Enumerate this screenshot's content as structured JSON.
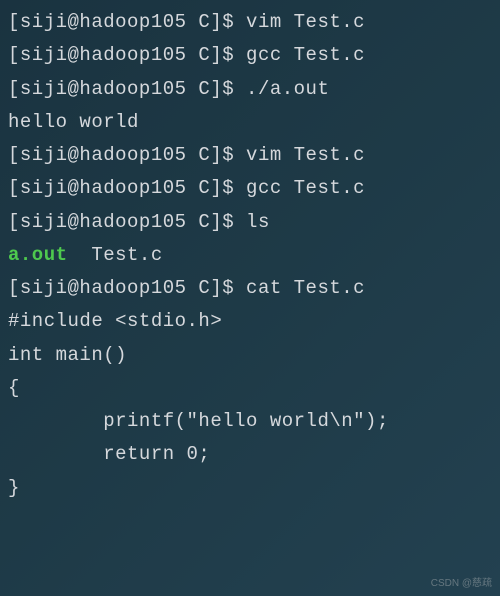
{
  "prompt": "[siji@hadoop105 C]$ ",
  "lines": [
    {
      "type": "cmd",
      "command": "vim Test.c"
    },
    {
      "type": "cmd",
      "command": "gcc Test.c"
    },
    {
      "type": "cmd",
      "command": "./a.out"
    },
    {
      "type": "out",
      "text": "hello world"
    },
    {
      "type": "cmd",
      "command": "vim Test.c"
    },
    {
      "type": "cmd",
      "command": "gcc Test.c"
    },
    {
      "type": "cmd",
      "command": "ls"
    },
    {
      "type": "ls",
      "executable": "a.out",
      "rest": "  Test.c"
    },
    {
      "type": "cmd",
      "command": "cat Test.c"
    },
    {
      "type": "out",
      "text": "#include <stdio.h>"
    },
    {
      "type": "out",
      "text": "int main()"
    },
    {
      "type": "out",
      "text": "{"
    },
    {
      "type": "out",
      "text": "        printf(\"hello world\\n\");"
    },
    {
      "type": "out",
      "text": "        return 0;"
    },
    {
      "type": "out",
      "text": "}"
    }
  ],
  "watermark": "CSDN @慈疏"
}
